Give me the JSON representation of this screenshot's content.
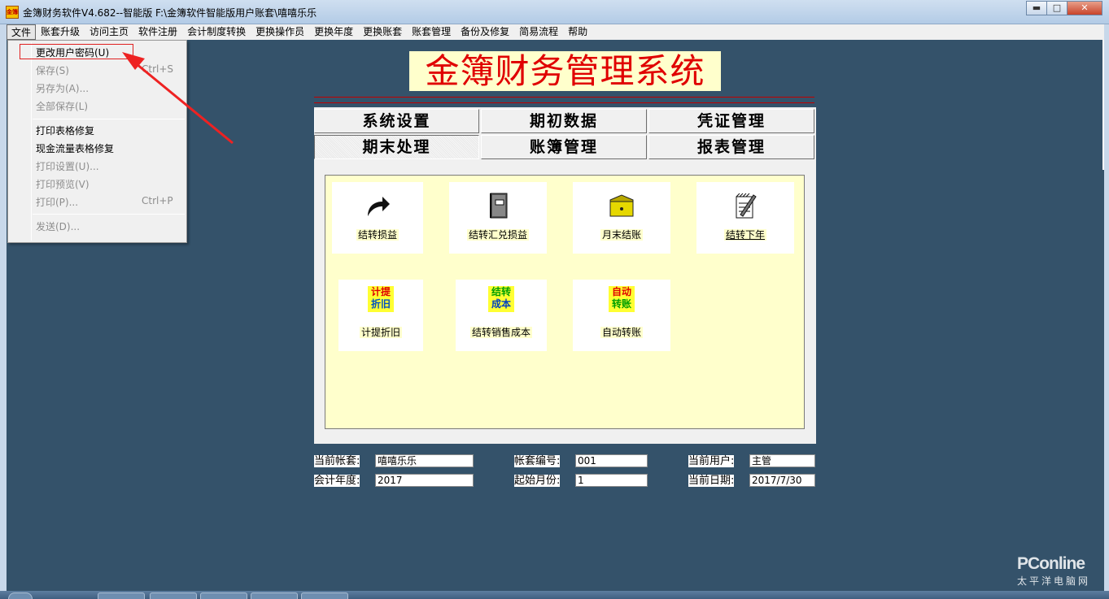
{
  "window": {
    "title": "金簿财务软件V4.682--智能版   F:\\金簿软件智能版用户账套\\嘻嘻乐乐",
    "app_icon_text": "金簿",
    "minimize_glyph": "▬",
    "maximize_glyph": "□",
    "close_glyph": "✕"
  },
  "menubar": {
    "items": [
      "文件",
      "账套升级",
      "访问主页",
      "软件注册",
      "会计制度转换",
      "更换操作员",
      "更换年度",
      "更换账套",
      "账套管理",
      "备份及修复",
      "简易流程",
      "帮助"
    ]
  },
  "file_menu": {
    "items": [
      {
        "label": "更改用户密码(U)",
        "shortcut": "Ctrl+S",
        "enabled": true
      },
      {
        "label": "保存(S)",
        "shortcut": "",
        "enabled": false
      },
      {
        "label": "另存为(A)...",
        "shortcut": "",
        "enabled": false
      },
      {
        "label": "全部保存(L)",
        "shortcut": "",
        "enabled": false
      },
      {
        "label": "打印表格修复",
        "shortcut": "",
        "enabled": true
      },
      {
        "label": "现金流量表格修复",
        "shortcut": "",
        "enabled": true
      },
      {
        "label": "打印设置(U)...",
        "shortcut": "",
        "enabled": false
      },
      {
        "label": "打印预览(V)",
        "shortcut": "",
        "enabled": false
      },
      {
        "label": "打印(P)...",
        "shortcut": "Ctrl+P",
        "enabled": false
      },
      {
        "label": "发送(D)...",
        "shortcut": "",
        "enabled": false
      }
    ]
  },
  "header": {
    "title": "金簿财务管理系统"
  },
  "tabs": [
    "系统设置",
    "期初数据",
    "凭证管理",
    "期末处理",
    "账簿管理",
    "报表管理"
  ],
  "active_tab": "期末处理",
  "actions": [
    {
      "label": "结转损益",
      "icon": "curved-arrow-icon"
    },
    {
      "label": "结转汇兑损益",
      "icon": "notebook-icon"
    },
    {
      "label": "月末结账",
      "icon": "folder-icon"
    },
    {
      "label": "结转下年",
      "icon": "notepad-pen-icon"
    },
    {
      "label": "计提折旧",
      "icon": "text-badge-icon",
      "badge": [
        "计提",
        "折旧"
      ]
    },
    {
      "label": "结转销售成本",
      "icon": "text-badge-icon",
      "badge": [
        "结转",
        "成本"
      ]
    },
    {
      "label": "自动转账",
      "icon": "text-badge-icon",
      "badge": [
        "自动",
        "转账"
      ]
    }
  ],
  "info": {
    "current_account_label": "当前帐套:",
    "current_account_value": "嘻嘻乐乐",
    "account_no_label": "帐套编号:",
    "account_no_value": "001",
    "current_user_label": "当前用户:",
    "current_user_value": "主管",
    "fiscal_year_label": "会计年度:",
    "fiscal_year_value": "2017",
    "start_month_label": "起始月份:",
    "start_month_value": "1",
    "current_date_label": "当前日期:",
    "current_date_value": "2017/7/30"
  },
  "watermark": {
    "brand": "PConline",
    "sub": "太平洋电脑网"
  },
  "colors": {
    "desktop": "#34526a",
    "title_red": "#e00000",
    "panel_yellow": "#ffffcc",
    "highlight_red": "#e02020"
  }
}
